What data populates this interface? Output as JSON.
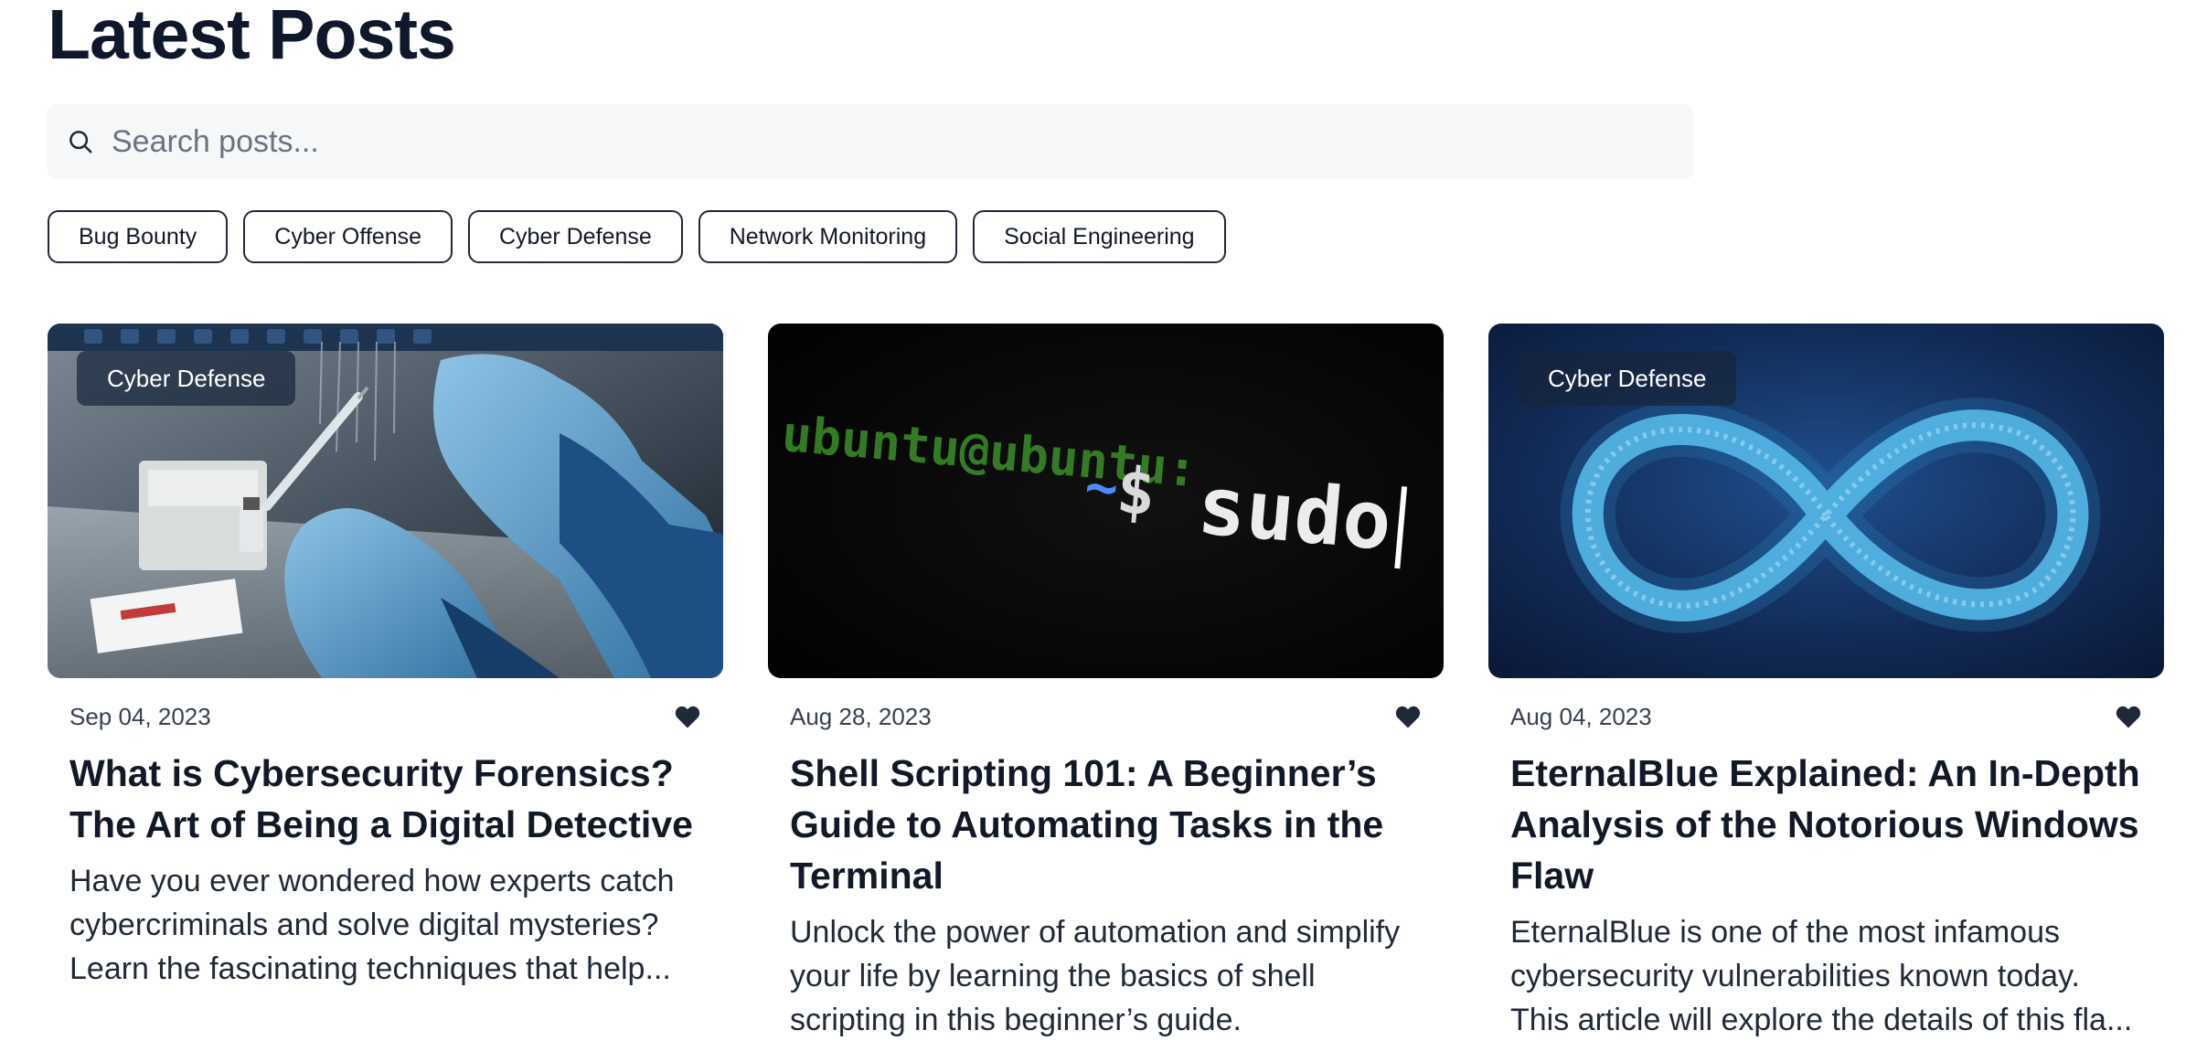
{
  "header": {
    "title": "Latest Posts"
  },
  "search": {
    "placeholder": "Search posts..."
  },
  "tags": [
    "Bug Bounty",
    "Cyber Offense",
    "Cyber Defense",
    "Network Monitoring",
    "Social Engineering"
  ],
  "posts": [
    {
      "category": "Cyber Defense",
      "date": "Sep 04, 2023",
      "title": "What is Cybersecurity Forensics? The Art of Being a Digital Detective",
      "excerpt": "Have you ever wondered how experts catch cybercriminals and solve digital mysteries? Learn the fascinating techniques that help...",
      "image_icon": "lab-gloves-syringe-image"
    },
    {
      "category": "",
      "date": "Aug 28, 2023",
      "title": "Shell Scripting 101: A Beginner’s Guide to Automating Tasks in the Terminal",
      "excerpt": "Unlock the power of automation and simplify your life by learning the basics of shell scripting in this beginner’s guide.",
      "image_icon": "terminal-sudo-image",
      "image_text": {
        "prompt": "ubuntu@ubuntu:",
        "path": "~",
        "dollar": "$",
        "command": "sudo"
      }
    },
    {
      "category": "Cyber Defense",
      "date": "Aug 04, 2023",
      "title": "EternalBlue Explained: An In-Depth Analysis of the Notorious Windows Flaw",
      "excerpt": "EternalBlue is one of the most infamous cybersecurity vulnerabilities known today. This article will explore the details of this fla...",
      "image_icon": "infinity-symbol-image"
    }
  ],
  "colors": {
    "heading": "#0f172a",
    "search_bg": "#f6f7f9",
    "tag_border": "#1f2937",
    "badge_bg": "#17253c",
    "heart": "#1f2937"
  }
}
